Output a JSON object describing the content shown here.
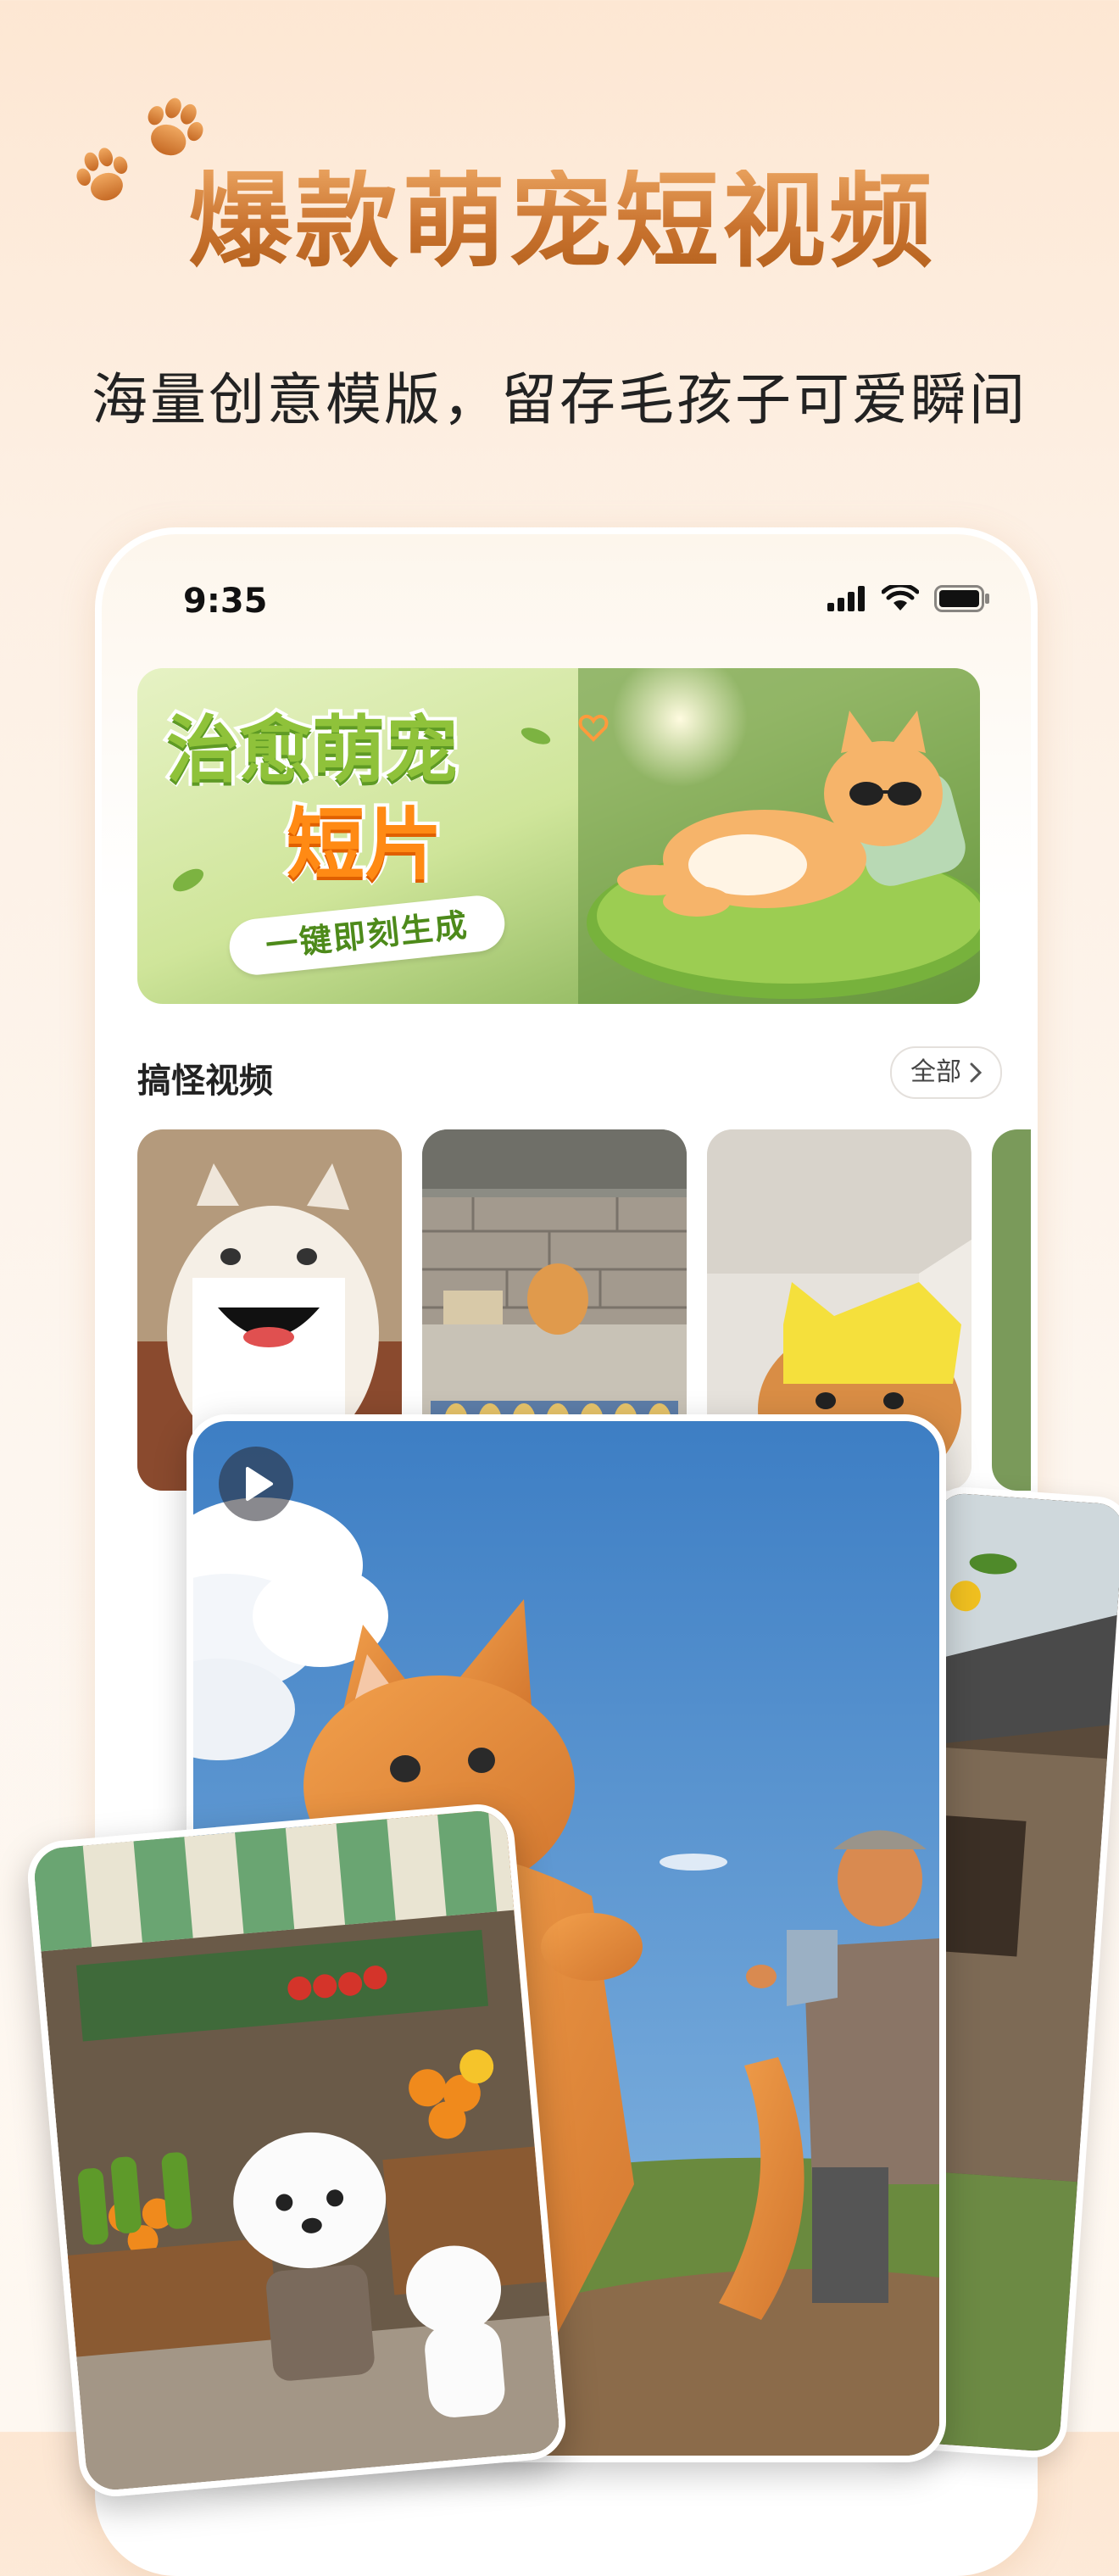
{
  "header": {
    "headline": "爆款萌宠短视频",
    "subtitle": "海量创意模版，留存毛孩子可爱瞬间"
  },
  "status_bar": {
    "time": "9:35",
    "icons": [
      "cellular-signal-icon",
      "wifi-icon",
      "battery-icon"
    ]
  },
  "banner": {
    "title_line1": "治愈萌宠",
    "title_line2": "短片",
    "tag": "一键即刻生成"
  },
  "section": {
    "title": "搞怪视频",
    "see_all_label": "全部",
    "see_all_icon": "chevron-right-icon"
  },
  "thumbnails": [
    {
      "subject": "cat-holding-smile-sign"
    },
    {
      "subject": "cat-selling-fish"
    },
    {
      "subject": "cat-in-yellow-hat"
    },
    {
      "subject": "partial-thumbnail"
    }
  ],
  "cards": {
    "main_icon": "play-icon",
    "main_subject": "orange-cat-running-from-grandma",
    "left_subject": "puppies-at-fruit-market",
    "right_subject": "village-house-with-lemon-tree"
  },
  "colors": {
    "headline_gradient_top": "#e8a05c",
    "headline_gradient_bottom": "#b5621e",
    "banner_green": "#8fc23a",
    "banner_orange": "#ff8a14",
    "background": "#fdf0e4"
  }
}
